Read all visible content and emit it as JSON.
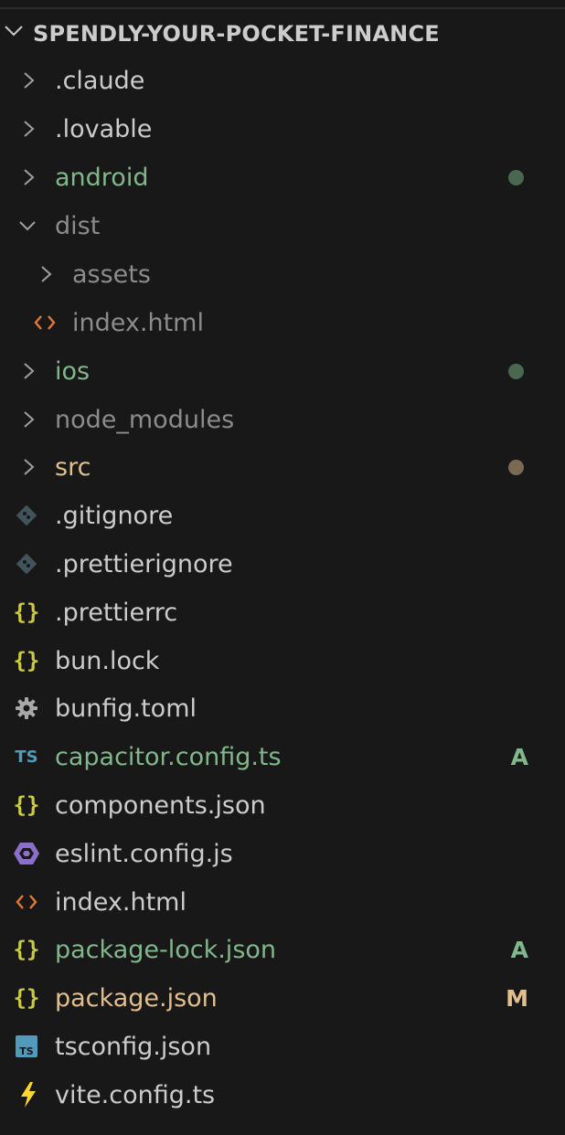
{
  "explorer": {
    "section_title": "SPENDLY-YOUR-POCKET-FINANCE",
    "colors": {
      "background": "#181818",
      "default_text": "#cccccc",
      "ignored_text": "#8c8c8c",
      "added_text": "#81b88b",
      "modified_text": "#e2c08d",
      "json_icon": "#cbcb41",
      "html_icon": "#e37933",
      "ts_icon": "#519aba",
      "eslint_icon": "#8b6fcb",
      "git_icon": "#41535b",
      "vite_icon": "#ffd62e"
    },
    "items": [
      {
        "label": ".claude",
        "type": "folder",
        "expanded": false,
        "status": "ignored"
      },
      {
        "label": ".lovable",
        "type": "folder",
        "expanded": false,
        "status": "default"
      },
      {
        "label": "android",
        "type": "folder",
        "expanded": false,
        "status": "added",
        "indicator": "dot"
      },
      {
        "label": "dist",
        "type": "folder",
        "expanded": true,
        "status": "ignored"
      },
      {
        "label": "assets",
        "type": "folder",
        "expanded": false,
        "status": "ignored",
        "depth": 1
      },
      {
        "label": "index.html",
        "type": "file",
        "icon": "html-icon",
        "status": "ignored",
        "depth": 1
      },
      {
        "label": "ios",
        "type": "folder",
        "expanded": false,
        "status": "added",
        "indicator": "dot"
      },
      {
        "label": "node_modules",
        "type": "folder",
        "expanded": false,
        "status": "ignored"
      },
      {
        "label": "src",
        "type": "folder",
        "expanded": false,
        "status": "modified",
        "indicator": "dot"
      },
      {
        "label": ".gitignore",
        "type": "file",
        "icon": "git-icon",
        "status": "default"
      },
      {
        "label": ".prettierignore",
        "type": "file",
        "icon": "git-icon",
        "status": "default"
      },
      {
        "label": ".prettierrc",
        "type": "file",
        "icon": "json-icon",
        "status": "default"
      },
      {
        "label": "bun.lock",
        "type": "file",
        "icon": "json-icon",
        "status": "default"
      },
      {
        "label": "bunfig.toml",
        "type": "file",
        "icon": "gear-icon",
        "status": "default"
      },
      {
        "label": "capacitor.config.ts",
        "type": "file",
        "icon": "typescript-icon",
        "status": "added",
        "badge": "A"
      },
      {
        "label": "components.json",
        "type": "file",
        "icon": "json-icon",
        "status": "default"
      },
      {
        "label": "eslint.config.js",
        "type": "file",
        "icon": "eslint-icon",
        "status": "default"
      },
      {
        "label": "index.html",
        "type": "file",
        "icon": "html-icon",
        "status": "default"
      },
      {
        "label": "package-lock.json",
        "type": "file",
        "icon": "json-icon",
        "status": "added",
        "badge": "A"
      },
      {
        "label": "package.json",
        "type": "file",
        "icon": "json-icon",
        "status": "modified",
        "badge": "M"
      },
      {
        "label": "tsconfig.json",
        "type": "file",
        "icon": "tsconfig-icon",
        "status": "default"
      },
      {
        "label": "vite.config.ts",
        "type": "file",
        "icon": "vite-icon",
        "status": "default"
      }
    ]
  }
}
